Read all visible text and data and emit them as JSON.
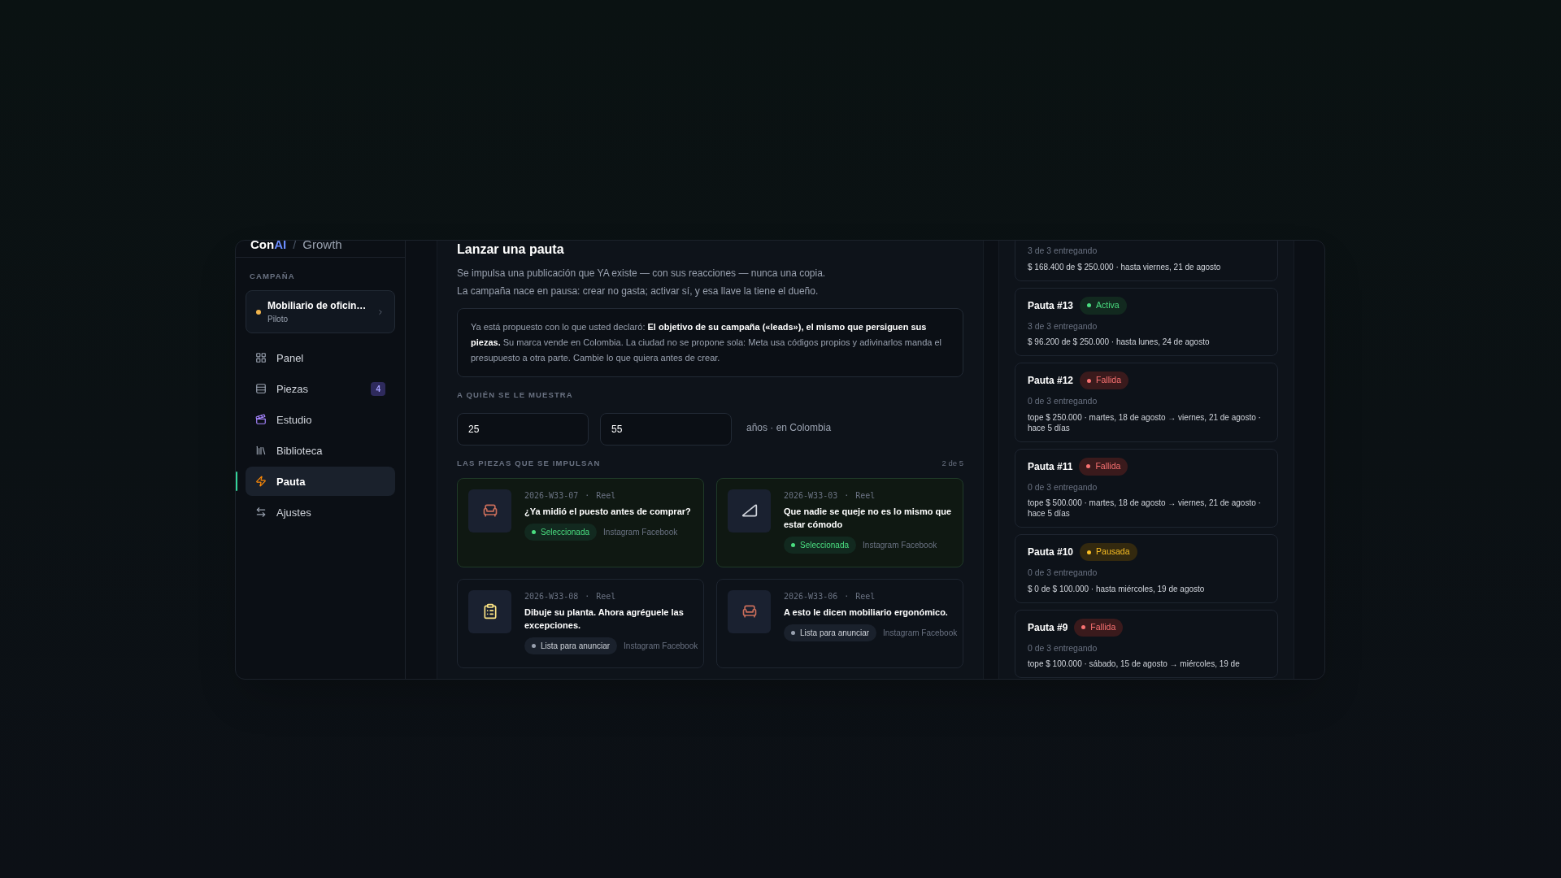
{
  "brand": {
    "first": "Con",
    "second": "AI",
    "separator": "/",
    "section": "Growth"
  },
  "sidebar": {
    "section_label": "CAMPAÑA",
    "campaign": {
      "name": "Mobiliario de oficin…",
      "status": "Piloto",
      "color": "#f0b44c"
    },
    "items": [
      {
        "label": "Panel",
        "selected": false
      },
      {
        "label": "Piezas",
        "selected": false,
        "badge": "4"
      },
      {
        "label": "Estudio",
        "selected": false
      },
      {
        "label": "Biblioteca",
        "selected": false
      },
      {
        "label": "Pauta",
        "selected": true
      },
      {
        "label": "Ajustes",
        "selected": false
      }
    ]
  },
  "main": {
    "title": "Lanzar una pauta",
    "intro": [
      "Se impulsa una publicación que YA existe — con sus reacciones — nunca una copia.",
      "La campaña nace en pausa: crear no gasta; activar sí, y esa llave la tiene el dueño."
    ],
    "note": "Ya está propuesto con lo que usted declaró: **El objetivo de su campaña («leads»), el mismo que persiguen sus piezas.** Su marca vende en Colombia. La ciudad no se propone sola: Meta usa códigos propios y adivinarlos manda el presupuesto a otra parte. Cambie lo que quiera antes de crear.",
    "audience_label": "A QUIÉN SE LE MUESTRA",
    "age_min": "25",
    "age_max": "55",
    "age_suffix": "años · en Colombia",
    "pieces_label": "LAS PIEZAS QUE SE IMPULSAN",
    "pieces_count": "2 de 5",
    "pieces": [
      {
        "code": "2026-W33-07",
        "separator": "·",
        "format": "Reel",
        "title": "¿Ya midió el puesto antes de comprar?",
        "status": "Seleccionada",
        "selected": true,
        "platforms": "Instagram Facebook"
      },
      {
        "code": "2026-W33-03",
        "separator": "·",
        "format": "Reel",
        "title": "Que nadie se queje no es lo mismo que estar cómodo",
        "status": "Seleccionada",
        "selected": true,
        "platforms": "Instagram Facebook"
      },
      {
        "code": "2026-W33-08",
        "separator": "·",
        "format": "Reel",
        "title": "Dibuje su planta. Ahora agréguele las excepciones.",
        "status": "Lista para anunciar",
        "selected": false,
        "platforms": "Instagram Facebook"
      },
      {
        "code": "2026-W33-06",
        "separator": "·",
        "format": "Reel",
        "title": "A esto le dicen mobiliario ergonómico.",
        "status": "Lista para anunciar",
        "selected": false,
        "platforms": "Instagram Facebook"
      }
    ]
  },
  "pautas": [
    {
      "delivery": "3 de 3 entregando",
      "detail": "$ 168.400 de $ 250.000 · hasta viernes, 21 de agosto"
    },
    {
      "title": "Pauta #13",
      "status": {
        "label": "Activa",
        "kind": "active"
      },
      "delivery": "3 de 3 entregando",
      "detail": "$ 96.200 de $ 250.000 · hasta lunes, 24 de agosto"
    },
    {
      "title": "Pauta #12",
      "status": {
        "label": "Fallida",
        "kind": "failed"
      },
      "delivery": "0 de 3 entregando",
      "detail": "tope $ 250.000 · martes, 18 de agosto → viernes, 21 de agosto · hace 5 días"
    },
    {
      "title": "Pauta #11",
      "status": {
        "label": "Fallida",
        "kind": "failed"
      },
      "delivery": "0 de 3 entregando",
      "detail": "tope $ 500.000 · martes, 18 de agosto → viernes, 21 de agosto · hace 5 días"
    },
    {
      "title": "Pauta #10",
      "status": {
        "label": "Pausada",
        "kind": "paused"
      },
      "delivery": "0 de 3 entregando",
      "detail": "$ 0 de $ 100.000 · hasta miércoles, 19 de agosto"
    },
    {
      "title": "Pauta #9",
      "status": {
        "label": "Fallida",
        "kind": "failed"
      },
      "delivery": "0 de 3 entregando",
      "detail": "tope $ 100.000 · sábado, 15 de agosto → miércoles, 19 de"
    }
  ]
}
